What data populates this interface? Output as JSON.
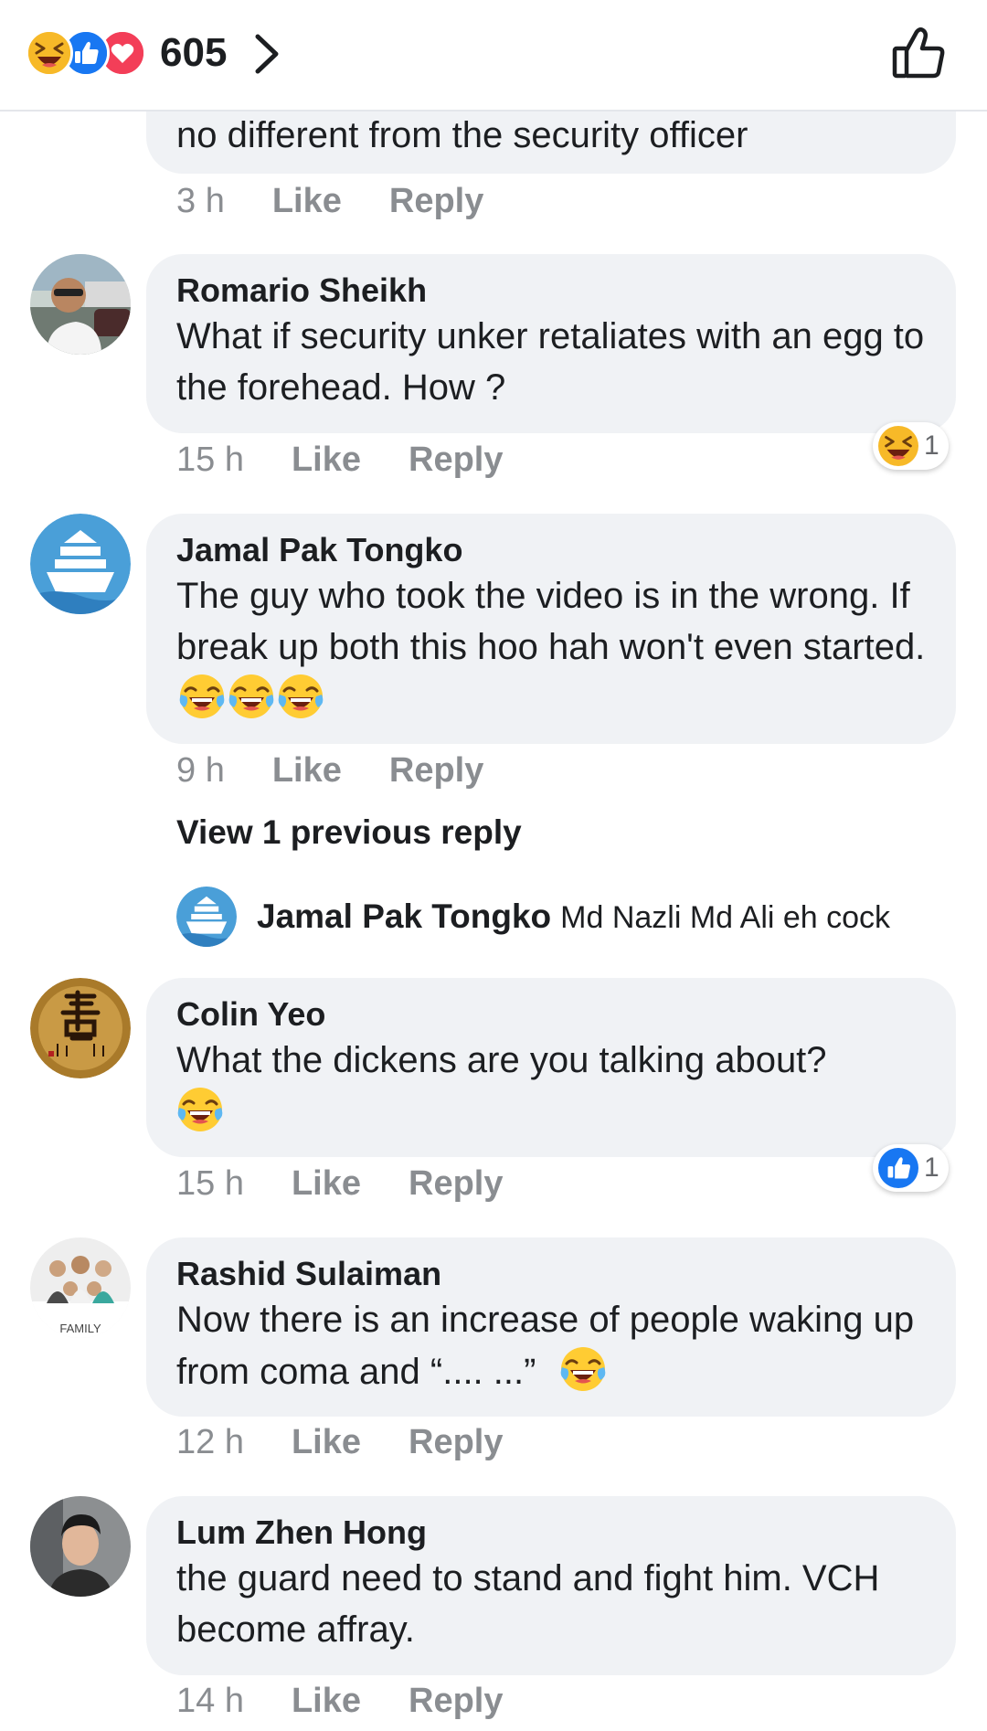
{
  "header": {
    "reaction_icons": [
      "haha-icon",
      "like-icon",
      "love-icon"
    ],
    "reaction_count": "605",
    "colors": {
      "haha": "#f7b928",
      "like": "#1877f2",
      "love": "#f33e58"
    }
  },
  "comments": [
    {
      "text": "no different from the security officer",
      "time": "3 h",
      "like_label": "Like",
      "reply_label": "Reply"
    },
    {
      "author": "Romario Sheikh",
      "text": "What if security unker retaliates with an egg to the forehead. How ?",
      "time": "15 h",
      "like_label": "Like",
      "reply_label": "Reply",
      "reaction": {
        "icon": "haha-icon",
        "count": "1"
      }
    },
    {
      "author": "Jamal Pak Tongko",
      "text": "The guy who took the video is in the wrong. If break up both this hoo hah won't even started.",
      "emojis": [
        "tears-of-joy-icon",
        "tears-of-joy-icon",
        "tears-of-joy-icon"
      ],
      "time": "9 h",
      "like_label": "Like",
      "reply_label": "Reply",
      "view_replies": "View 1 previous reply",
      "reply": {
        "author": "Jamal Pak Tongko",
        "text": "Md Nazli Md Ali eh cock"
      }
    },
    {
      "author": "Colin Yeo",
      "text": "What the dickens are you talking about?",
      "emojis": [
        "tears-of-joy-icon"
      ],
      "time": "15 h",
      "like_label": "Like",
      "reply_label": "Reply",
      "reaction": {
        "icon": "like-icon",
        "count": "1"
      }
    },
    {
      "author": "Rashid Sulaiman",
      "text": "Now there is an increase of people waking up from coma and “.... ...”",
      "emojis": [
        "tears-of-joy-icon"
      ],
      "time": "12 h",
      "like_label": "Like",
      "reply_label": "Reply",
      "avatar_caption": "FAMILY"
    },
    {
      "author": "Lum Zhen Hong",
      "text": "the guard need to stand and fight him. VCH become affray.",
      "time": "14 h",
      "like_label": "Like",
      "reply_label": "Reply"
    }
  ]
}
